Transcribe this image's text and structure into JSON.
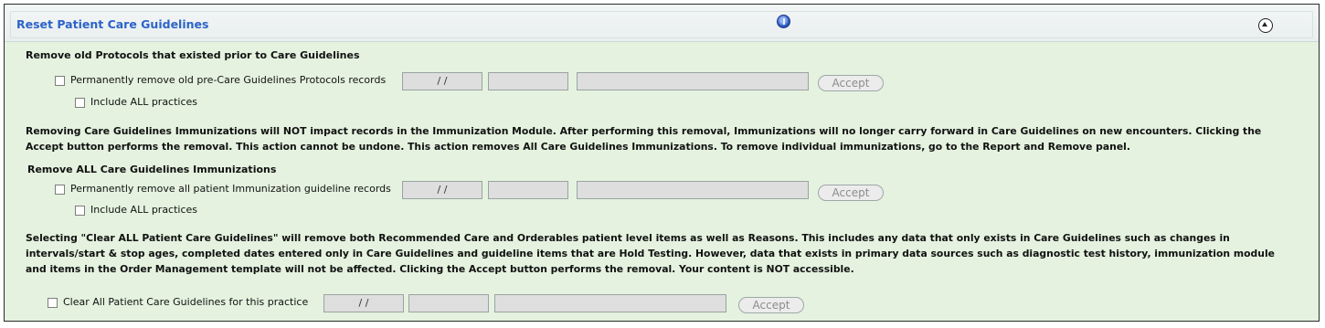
{
  "panel": {
    "title": "Reset Patient Care Guidelines"
  },
  "protocols": {
    "heading": "Remove old Protocols that existed prior to Care Guidelines",
    "remove_label": "Permanently remove old pre-Care Guidelines Protocols records",
    "date_value": "/ /",
    "include_label": "Include ALL practices",
    "accept_label": "Accept"
  },
  "immunizations": {
    "info_text": "Removing Care Guidelines Immunizations will NOT impact records in the Immunization Module. After performing this removal, Immunizations will no longer carry forward in Care Guidelines on new encounters. Clicking the Accept button performs the removal. This action cannot be undone. This action removes All Care Guidelines Immunizations. To remove individual immunizations, go to the Report and Remove panel.",
    "heading": "Remove ALL Care Guidelines Immunizations",
    "remove_label": "Permanently remove all patient Immunization guideline records",
    "date_value": "/ /",
    "include_label": "Include ALL practices",
    "accept_label": "Accept"
  },
  "clear_all": {
    "info_text": "Selecting \"Clear ALL Patient Care Guidelines\" will remove both Recommended Care and Orderables patient level items as well as Reasons.  This includes any data that only exists in Care Guidelines such as changes in intervals/start & stop ages, completed dates entered only in Care Guidelines and guideline items that are Hold Testing. However, data that exists in primary data sources such as diagnostic test history, immunization module and items in the Order Management template will not be affected. Clicking the Accept button performs the removal.  Your content is NOT accessible.",
    "remove_label": "Clear All Patient Care Guidelines for this practice",
    "date_value": "/ /",
    "accept_label": "Accept"
  },
  "icons": {
    "info": "info-icon",
    "collapse": "collapse-up-icon"
  },
  "colors": {
    "title": "#2c63c9",
    "panel_background": "#e4f2df"
  }
}
